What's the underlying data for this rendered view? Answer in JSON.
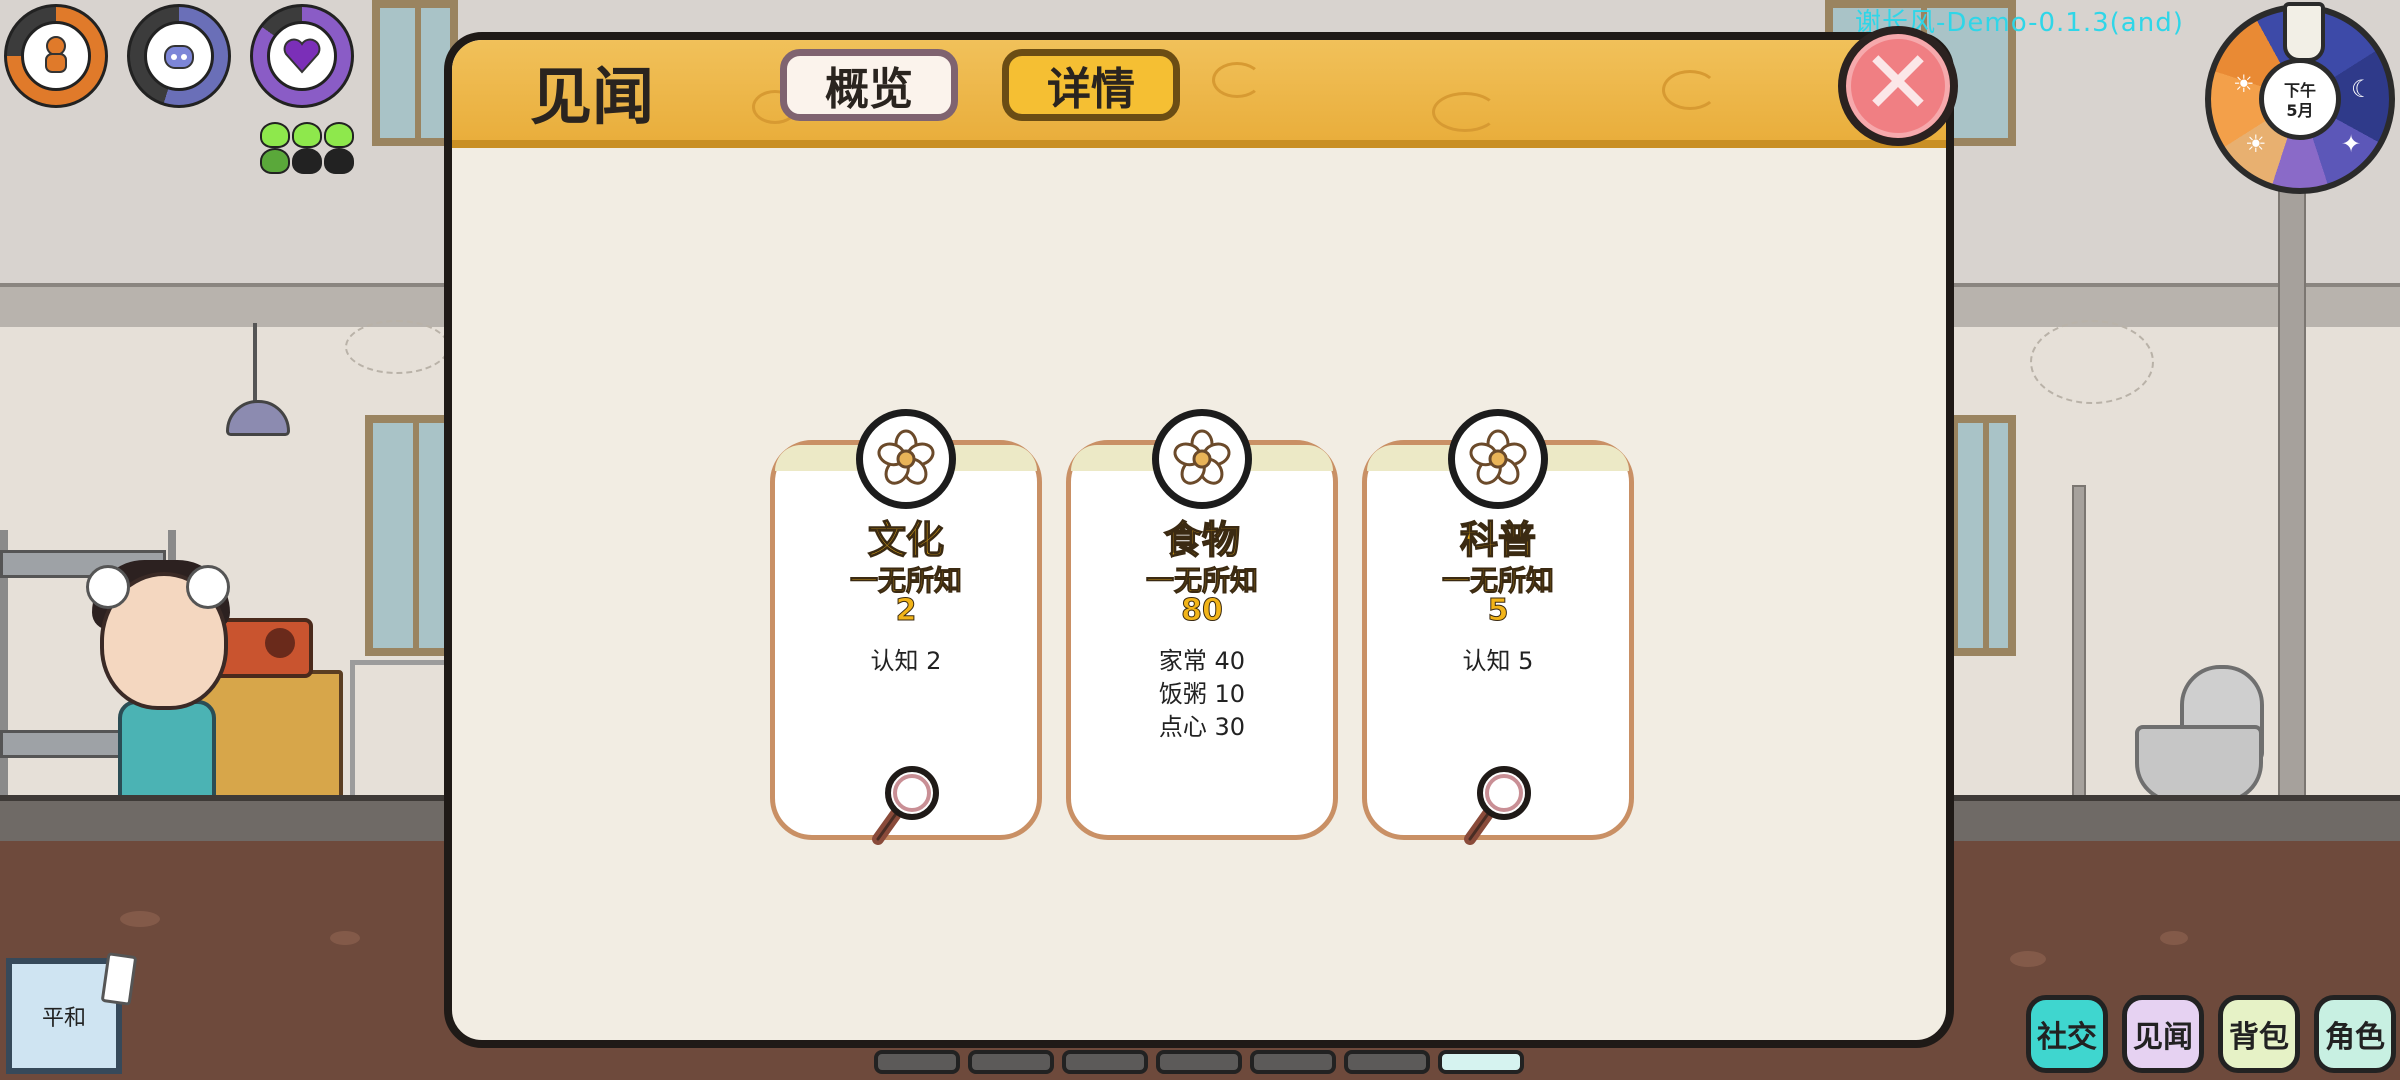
{
  "hud": {
    "stats": [
      {
        "name": "body-stat",
        "icon": "figure-icon",
        "color": "#e07a2a"
      },
      {
        "name": "mind-stat",
        "icon": "robot-face-icon",
        "color": "#6a6fb8"
      },
      {
        "name": "heart-stat",
        "icon": "heart-icon",
        "color": "#8a5cc6"
      }
    ],
    "version": "谢长风-Demo-0.1.3(and)",
    "clock": {
      "period": "下午",
      "month": "5月"
    }
  },
  "dialog": {
    "title": "见闻",
    "tabs": {
      "overview": "概览",
      "details": "详情"
    },
    "active_tab": "概览",
    "close_icon": "close-icon",
    "cards": [
      {
        "name": "文化",
        "level": "一无所知",
        "score": "2",
        "lines": [
          "认知 2"
        ],
        "has_magnifier": true
      },
      {
        "name": "食物",
        "level": "一无所知",
        "score": "80",
        "lines": [
          "家常 40",
          "饭粥 10",
          "点心 30"
        ],
        "has_magnifier": false
      },
      {
        "name": "科普",
        "level": "一无所知",
        "score": "5",
        "lines": [
          "认知 5"
        ],
        "has_magnifier": true
      }
    ]
  },
  "bottom": {
    "mood": "平和",
    "nav": [
      {
        "label": "社交",
        "color": "#3fd6cf"
      },
      {
        "label": "见闻",
        "color": "#e6d2f2"
      },
      {
        "label": "背包",
        "color": "#e6f2c6"
      },
      {
        "label": "角色",
        "color": "#c8f0e2"
      }
    ],
    "pages": 7,
    "active_page": 7
  }
}
